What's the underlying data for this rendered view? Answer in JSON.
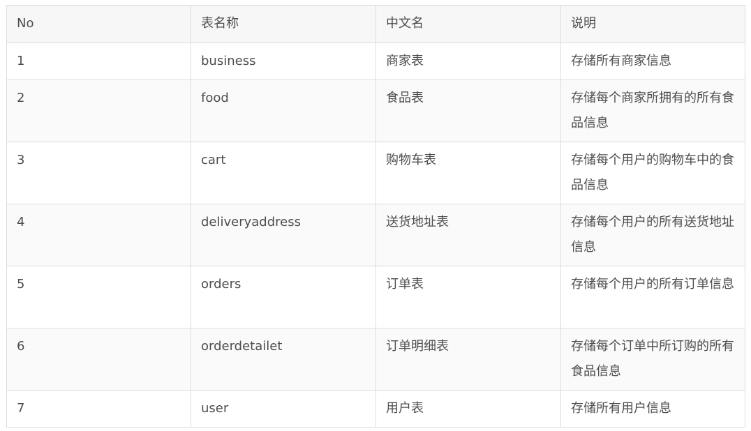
{
  "table": {
    "headers": [
      "No",
      "表名称",
      "中文名",
      "说明"
    ],
    "rows": [
      {
        "no": "1",
        "name": "business",
        "cn_name": "商家表",
        "desc": "存储所有商家信息"
      },
      {
        "no": "2",
        "name": "food",
        "cn_name": "食品表",
        "desc": "存储每个商家所拥有的所有食品信息"
      },
      {
        "no": "3",
        "name": "cart",
        "cn_name": "购物车表",
        "desc": "存储每个用户的购物车中的食品信息"
      },
      {
        "no": "4",
        "name": "deliveryaddress",
        "cn_name": "送货地址表",
        "desc": "存储每个用户的所有送货地址信息"
      },
      {
        "no": "5",
        "name": "orders",
        "cn_name": "订单表",
        "desc": "存储每个用户的所有订单信息"
      },
      {
        "no": "6",
        "name": "orderdetailet",
        "cn_name": "订单明细表",
        "desc": "存储每个订单中所订购的所有食品信息"
      },
      {
        "no": "7",
        "name": "user",
        "cn_name": "用户表",
        "desc": "存储所有用户信息"
      }
    ]
  }
}
